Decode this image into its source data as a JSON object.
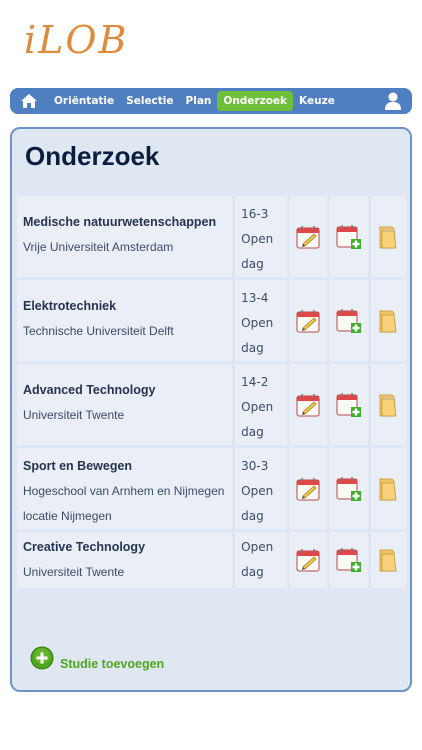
{
  "app": {
    "logo_text": "iLOB"
  },
  "nav": {
    "items": [
      {
        "label": "Oriëntatie",
        "active": false
      },
      {
        "label": "Selectie",
        "active": false
      },
      {
        "label": "Plan",
        "active": false
      },
      {
        "label": "Onderzoek",
        "active": true
      },
      {
        "label": "Keuze",
        "active": false
      }
    ]
  },
  "main": {
    "title": "Onderzoek",
    "studies": [
      {
        "name": "Medische natuurwetenschappen",
        "institution": "Vrije Universiteit Amsterdam",
        "date": "16-3",
        "event": "Open dag"
      },
      {
        "name": "Elektrotechniek",
        "institution": "Technische Universiteit Delft",
        "date": "13-4",
        "event": "Open dag"
      },
      {
        "name": "Advanced Technology",
        "institution": "Universiteit Twente",
        "date": "14-2",
        "event": "Open dag"
      },
      {
        "name": "Sport en Bewegen",
        "institution": "Hogeschool van Arnhem en Nijmegen locatie Nijmegen",
        "date": "30-3",
        "event": "Open dag"
      },
      {
        "name": "Creative Technology",
        "institution": "Universiteit Twente",
        "date": "",
        "event": "Open dag"
      }
    ],
    "add_label": "Studie toevoegen"
  },
  "colors": {
    "accent": "#4f7fc0",
    "active": "#6ec03a",
    "add": "#4ea61e",
    "logo": "#e08a3c"
  }
}
